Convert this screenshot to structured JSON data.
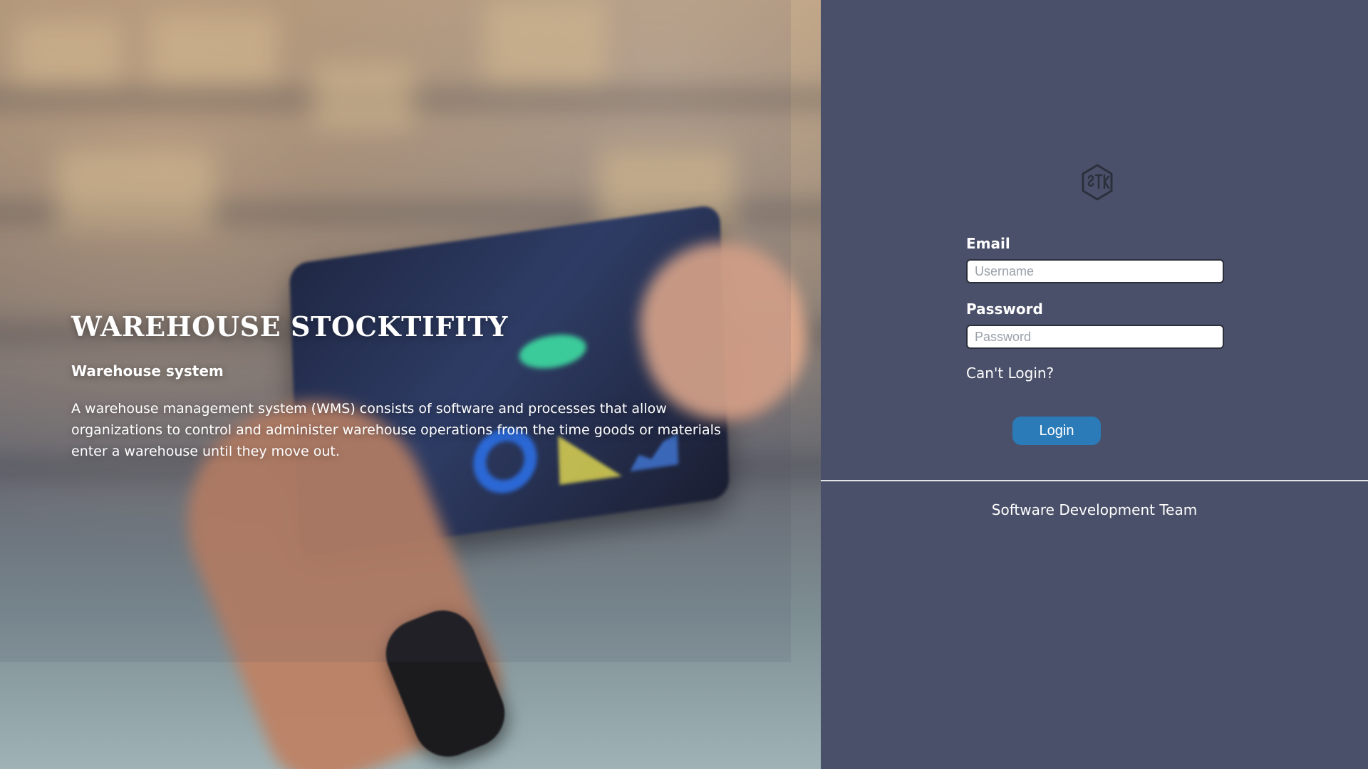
{
  "hero": {
    "title": "WAREHOUSE STOCKTIFITY",
    "subtitle": "Warehouse system",
    "description": "A warehouse management system (WMS) consists of software and processes that allow organizations to control and administer warehouse operations from the time goods or materials enter a warehouse until they move out."
  },
  "login": {
    "logo_icon": "stk-hexagon-logo-icon",
    "email_label": "Email",
    "email_placeholder": "Username",
    "email_value": "",
    "password_label": "Password",
    "password_placeholder": "Password",
    "password_value": "",
    "cant_login_text": "Can't Login?",
    "login_button_label": "Login"
  },
  "footer": {
    "team_text": "Software Development Team"
  },
  "colors": {
    "panel_background": "#4a5069",
    "login_button": "#2b7bb9",
    "text_primary": "#ffffff"
  }
}
